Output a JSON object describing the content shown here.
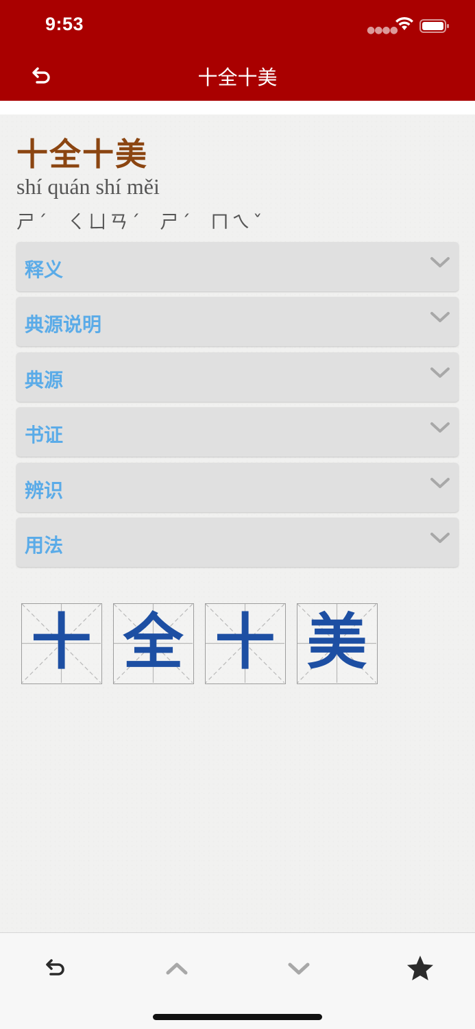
{
  "status_bar": {
    "time": "9:53"
  },
  "nav": {
    "title": "十全十美"
  },
  "entry": {
    "idiom": "十全十美",
    "pinyin": "shí quán shí měi",
    "zhuyin": "ㄕˊ  ㄑㄩㄢˊ  ㄕˊ  ㄇㄟˇ"
  },
  "sections": [
    {
      "label": "释义"
    },
    {
      "label": "典源说明"
    },
    {
      "label": "典源"
    },
    {
      "label": "书证"
    },
    {
      "label": "辨识"
    },
    {
      "label": "用法"
    }
  ],
  "characters": [
    "十",
    "全",
    "十",
    "美"
  ],
  "icons": {
    "back": "back-arrow-icon",
    "prev": "chevron-up-icon",
    "next": "chevron-down-icon",
    "favorite": "star-icon"
  },
  "colors": {
    "header": "#a90000",
    "idiom_title": "#8b4511",
    "section_label": "#5aabe8",
    "character": "#1d4fa3"
  }
}
